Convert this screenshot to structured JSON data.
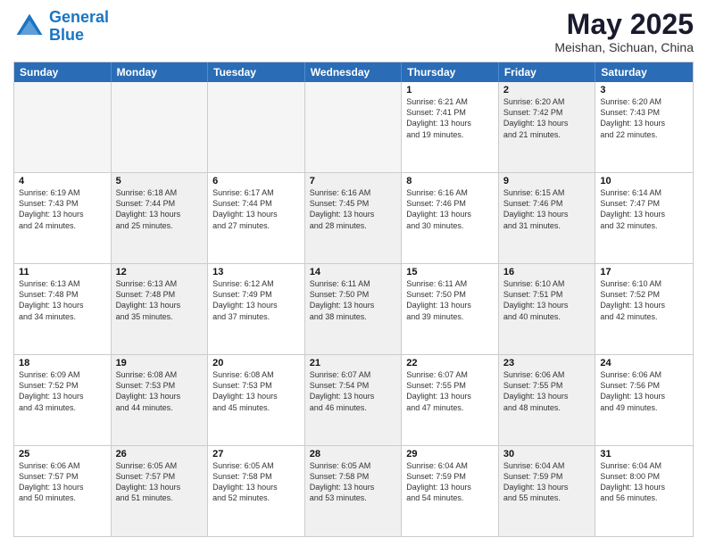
{
  "logo": {
    "line1": "General",
    "line2": "Blue"
  },
  "title": "May 2025",
  "location": "Meishan, Sichuan, China",
  "weekdays": [
    "Sunday",
    "Monday",
    "Tuesday",
    "Wednesday",
    "Thursday",
    "Friday",
    "Saturday"
  ],
  "rows": [
    [
      {
        "day": "",
        "info": "",
        "empty": true
      },
      {
        "day": "",
        "info": "",
        "empty": true
      },
      {
        "day": "",
        "info": "",
        "empty": true
      },
      {
        "day": "",
        "info": "",
        "empty": true
      },
      {
        "day": "1",
        "info": "Sunrise: 6:21 AM\nSunset: 7:41 PM\nDaylight: 13 hours\nand 19 minutes."
      },
      {
        "day": "2",
        "info": "Sunrise: 6:20 AM\nSunset: 7:42 PM\nDaylight: 13 hours\nand 21 minutes.",
        "shaded": true
      },
      {
        "day": "3",
        "info": "Sunrise: 6:20 AM\nSunset: 7:43 PM\nDaylight: 13 hours\nand 22 minutes."
      }
    ],
    [
      {
        "day": "4",
        "info": "Sunrise: 6:19 AM\nSunset: 7:43 PM\nDaylight: 13 hours\nand 24 minutes."
      },
      {
        "day": "5",
        "info": "Sunrise: 6:18 AM\nSunset: 7:44 PM\nDaylight: 13 hours\nand 25 minutes.",
        "shaded": true
      },
      {
        "day": "6",
        "info": "Sunrise: 6:17 AM\nSunset: 7:44 PM\nDaylight: 13 hours\nand 27 minutes."
      },
      {
        "day": "7",
        "info": "Sunrise: 6:16 AM\nSunset: 7:45 PM\nDaylight: 13 hours\nand 28 minutes.",
        "shaded": true
      },
      {
        "day": "8",
        "info": "Sunrise: 6:16 AM\nSunset: 7:46 PM\nDaylight: 13 hours\nand 30 minutes."
      },
      {
        "day": "9",
        "info": "Sunrise: 6:15 AM\nSunset: 7:46 PM\nDaylight: 13 hours\nand 31 minutes.",
        "shaded": true
      },
      {
        "day": "10",
        "info": "Sunrise: 6:14 AM\nSunset: 7:47 PM\nDaylight: 13 hours\nand 32 minutes."
      }
    ],
    [
      {
        "day": "11",
        "info": "Sunrise: 6:13 AM\nSunset: 7:48 PM\nDaylight: 13 hours\nand 34 minutes."
      },
      {
        "day": "12",
        "info": "Sunrise: 6:13 AM\nSunset: 7:48 PM\nDaylight: 13 hours\nand 35 minutes.",
        "shaded": true
      },
      {
        "day": "13",
        "info": "Sunrise: 6:12 AM\nSunset: 7:49 PM\nDaylight: 13 hours\nand 37 minutes."
      },
      {
        "day": "14",
        "info": "Sunrise: 6:11 AM\nSunset: 7:50 PM\nDaylight: 13 hours\nand 38 minutes.",
        "shaded": true
      },
      {
        "day": "15",
        "info": "Sunrise: 6:11 AM\nSunset: 7:50 PM\nDaylight: 13 hours\nand 39 minutes."
      },
      {
        "day": "16",
        "info": "Sunrise: 6:10 AM\nSunset: 7:51 PM\nDaylight: 13 hours\nand 40 minutes.",
        "shaded": true
      },
      {
        "day": "17",
        "info": "Sunrise: 6:10 AM\nSunset: 7:52 PM\nDaylight: 13 hours\nand 42 minutes."
      }
    ],
    [
      {
        "day": "18",
        "info": "Sunrise: 6:09 AM\nSunset: 7:52 PM\nDaylight: 13 hours\nand 43 minutes."
      },
      {
        "day": "19",
        "info": "Sunrise: 6:08 AM\nSunset: 7:53 PM\nDaylight: 13 hours\nand 44 minutes.",
        "shaded": true
      },
      {
        "day": "20",
        "info": "Sunrise: 6:08 AM\nSunset: 7:53 PM\nDaylight: 13 hours\nand 45 minutes."
      },
      {
        "day": "21",
        "info": "Sunrise: 6:07 AM\nSunset: 7:54 PM\nDaylight: 13 hours\nand 46 minutes.",
        "shaded": true
      },
      {
        "day": "22",
        "info": "Sunrise: 6:07 AM\nSunset: 7:55 PM\nDaylight: 13 hours\nand 47 minutes."
      },
      {
        "day": "23",
        "info": "Sunrise: 6:06 AM\nSunset: 7:55 PM\nDaylight: 13 hours\nand 48 minutes.",
        "shaded": true
      },
      {
        "day": "24",
        "info": "Sunrise: 6:06 AM\nSunset: 7:56 PM\nDaylight: 13 hours\nand 49 minutes."
      }
    ],
    [
      {
        "day": "25",
        "info": "Sunrise: 6:06 AM\nSunset: 7:57 PM\nDaylight: 13 hours\nand 50 minutes."
      },
      {
        "day": "26",
        "info": "Sunrise: 6:05 AM\nSunset: 7:57 PM\nDaylight: 13 hours\nand 51 minutes.",
        "shaded": true
      },
      {
        "day": "27",
        "info": "Sunrise: 6:05 AM\nSunset: 7:58 PM\nDaylight: 13 hours\nand 52 minutes."
      },
      {
        "day": "28",
        "info": "Sunrise: 6:05 AM\nSunset: 7:58 PM\nDaylight: 13 hours\nand 53 minutes.",
        "shaded": true
      },
      {
        "day": "29",
        "info": "Sunrise: 6:04 AM\nSunset: 7:59 PM\nDaylight: 13 hours\nand 54 minutes."
      },
      {
        "day": "30",
        "info": "Sunrise: 6:04 AM\nSunset: 7:59 PM\nDaylight: 13 hours\nand 55 minutes.",
        "shaded": true
      },
      {
        "day": "31",
        "info": "Sunrise: 6:04 AM\nSunset: 8:00 PM\nDaylight: 13 hours\nand 56 minutes."
      }
    ]
  ]
}
